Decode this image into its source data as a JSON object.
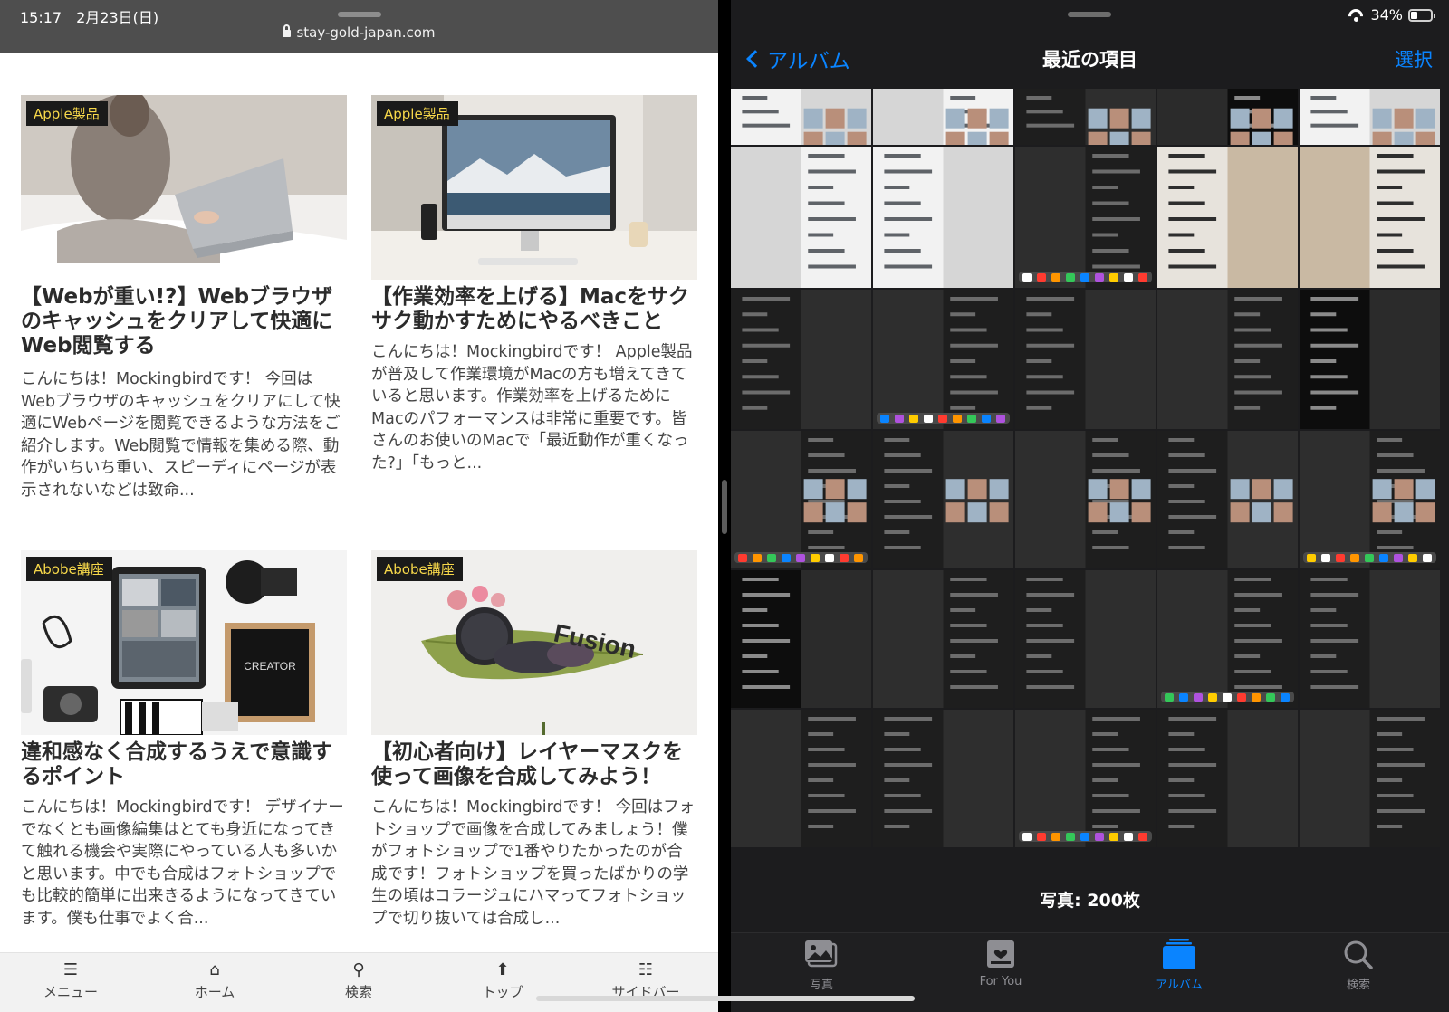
{
  "left": {
    "status": {
      "time": "15:17　2月23日(日)",
      "url": "stay-gold-japan.com"
    },
    "cards": [
      {
        "badge": "Apple製品",
        "title": "【Webが重い!?】Webブラウザのキャッシュをクリアして快適にWeb閲覧する",
        "excerpt": "こんにちは！Mockingbirdです！ 今回はWebブラウザのキャッシュをクリアにして快適にWebページを閲覧できるような方法をご紹介します。Web閲覧で情報を集める際、動作がいちいち重い、スピーディにページが表示されないなどは致命..."
      },
      {
        "badge": "Apple製品",
        "title": "【作業効率を上げる】Macをサクサク動かすためにやるべきこと",
        "excerpt": "こんにちは！Mockingbirdです！ Apple製品が普及して作業環境がMacの方も増えてきていると思います。作業効率を上げるためにMacのパフォーマンスは非常に重要です。皆さんのお使いのMacで「最近動作が重くなった?」「もっと..."
      },
      {
        "badge": "Abobe講座",
        "title": "違和感なく合成するうえで意識するポイント",
        "excerpt": "こんにちは！Mockingbirdです！ デザイナーでなくとも画像編集はとても身近になってきて触れる機会や実際にやっている人も多いかと思います。中でも合成はフォトショップでも比較的簡単に出来きるようになってきています。僕も仕事でよく合..."
      },
      {
        "badge": "Abobe講座",
        "title": "【初心者向け】レイヤーマスクを使って画像を合成してみよう！",
        "excerpt": "こんにちは！Mockingbirdです！ 今回はフォトショップで画像を合成してみましょう！僕がフォトショップで1番やりたかったのが合成です！フォトショップを買ったばかりの学生の頃はコラージュにハマってフォトショップで切り抜いては合成し..."
      }
    ],
    "thumb_texts": {
      "fusion": "Fusion",
      "creator": "CREATOR"
    },
    "tabbar": [
      {
        "label": "メニュー",
        "icon": "menu-icon"
      },
      {
        "label": "ホーム",
        "icon": "home-icon"
      },
      {
        "label": "検索",
        "icon": "search-icon"
      },
      {
        "label": "トップ",
        "icon": "arrow-up-icon"
      },
      {
        "label": "サイドバー",
        "icon": "sidebar-icon"
      }
    ]
  },
  "right": {
    "status": {
      "battery": "34%",
      "battery_level": 0.34
    },
    "nav": {
      "back": "アルバム",
      "title": "最近の項目",
      "select": "選択"
    },
    "photo_count": "写真: 200枚",
    "tabbar": [
      {
        "label": "写真",
        "icon": "photos-icon",
        "active": false
      },
      {
        "label": "For You",
        "icon": "for-you-icon",
        "active": false
      },
      {
        "label": "アルバム",
        "icon": "albums-icon",
        "active": true
      },
      {
        "label": "検索",
        "icon": "search-icon",
        "active": false
      }
    ]
  },
  "colors": {
    "accent": "#0a84ff",
    "badge_text": "#f7d84a",
    "badge_bg": "#1a1a1a"
  }
}
